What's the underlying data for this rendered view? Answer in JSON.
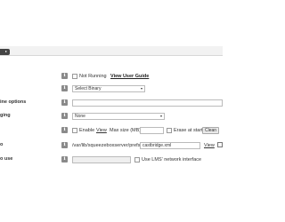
{
  "labels": {
    "options": "ine options",
    "logging": "ging",
    "config_file": "o",
    "network": "o use"
  },
  "status": {
    "checkbox_label": "Not Running",
    "guide_link": "View User Guide"
  },
  "binary": {
    "selected": "Select Binary"
  },
  "logging": {
    "selected": "None",
    "enable_label": "Enable",
    "view_link": "View",
    "max_size_label": "Max size (MB)",
    "erase_label": "Erase at start",
    "clean_button": "Clean"
  },
  "config": {
    "path": "/var/lib/squeezeboxserver/prefs",
    "file": "castbridge.xml",
    "view_link": "View"
  },
  "network": {
    "checkbox_label": "Use LMS' network interface"
  },
  "icons": {
    "info": "i"
  }
}
